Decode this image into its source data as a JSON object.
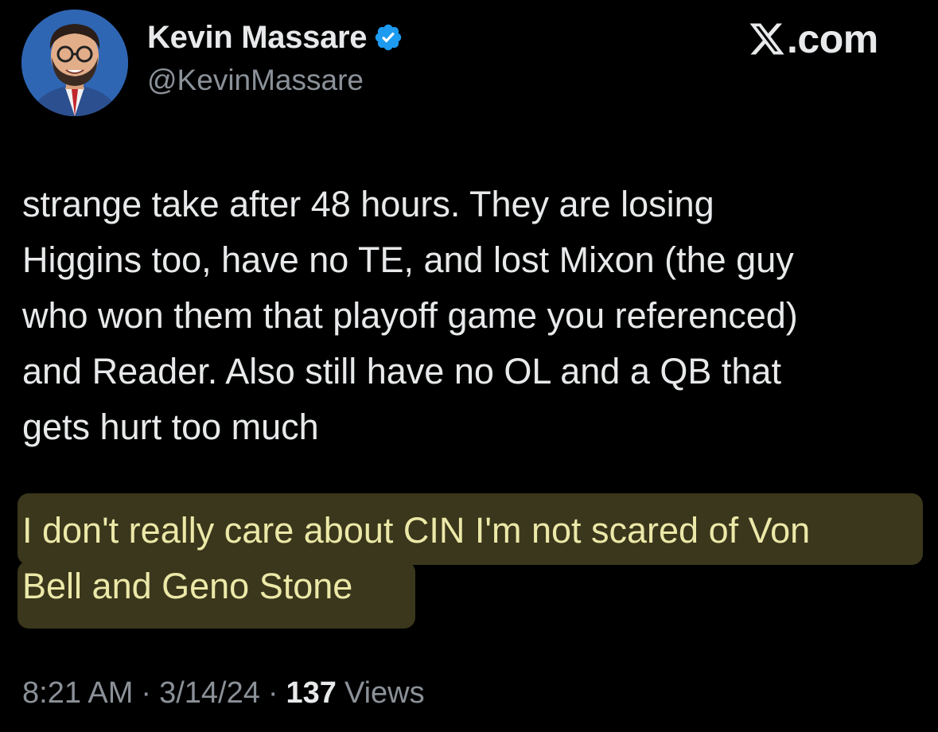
{
  "author": {
    "display_name": "Kevin Massare",
    "handle": "@KevinMassare",
    "verified": true,
    "avatar_icon": "profile-avatar"
  },
  "brand": {
    "logo_icon": "x-logo-icon",
    "text": ".com"
  },
  "tweet": {
    "body": "strange take after 48 hours. They are losing\nHiggins too, have no TE, and lost Mixon (the guy\nwho won them that playoff game you referenced)\nand Reader. Also still have no OL and a QB that\ngets hurt too much",
    "highlighted": "I don't really care about CIN I'm not scared of Von\nBell and Geno Stone"
  },
  "meta": {
    "time": "8:21 AM",
    "separator": "·",
    "date": "3/14/24",
    "views_count": "137",
    "views_label": "Views"
  },
  "colors": {
    "background": "#000000",
    "text_primary": "#e7e9ea",
    "text_secondary": "#8b9198",
    "verified_blue": "#1d9bf0",
    "highlight_bg": "#3a371c",
    "highlight_text": "#ece8a8"
  }
}
